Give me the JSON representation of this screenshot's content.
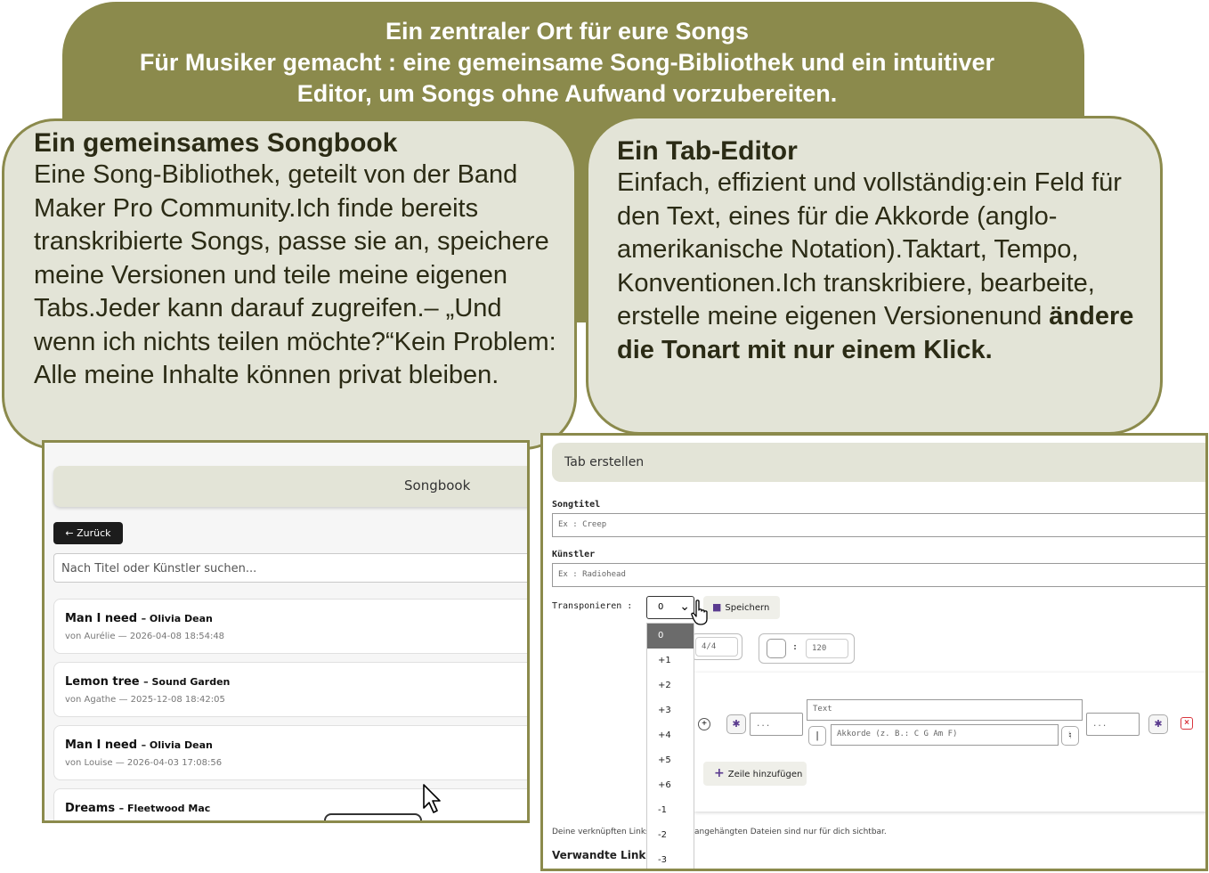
{
  "banner": {
    "line1": "Ein zentraler Ort für eure Songs",
    "line2": "Für Musiker gemacht : eine gemeinsame Song‑Bibliothek und ein intuitiver",
    "line3": "Editor, um Songs ohne Aufwand vorzubereiten."
  },
  "left_card": {
    "title": "Ein gemeinsames Songbook",
    "body": "Eine Song-Bibliothek, geteilt von der Band Maker Pro Community.Ich finde bereits transkribierte Songs, passe sie an, speichere meine Versionen und teile meine eigenen Tabs.Jeder kann darauf zugreifen.– „Und wenn ich nichts teilen möchte?“Kein Problem: Alle meine Inhalte können privat bleiben."
  },
  "right_card": {
    "title": "Ein Tab-Editor",
    "body": "Einfach, effizient und vollständig:ein Feld für den Text, eines für die Akkorde (anglo-amerikanische Notation).Taktart, Tempo, Konventionen.Ich transkribiere, bearbeite, erstelle meine eigenen Versionenund ",
    "body_bold": "ändere die Tonart mit nur einem Klick."
  },
  "songbook": {
    "header": "Songbook",
    "back_label": "← Zurück",
    "search_placeholder": "Nach Titel oder Künstler suchen...",
    "songs": [
      {
        "title": "Man I need",
        "artist": "– Olivia Dean",
        "meta": "von Aurélie — 2026-04-08 18:54:48"
      },
      {
        "title": "Lemon tree",
        "artist": "– Sound Garden",
        "meta": "von Agathe — 2025-12-08 18:42:05"
      },
      {
        "title": "Man I need",
        "artist": "– Olivia Dean",
        "meta": "von Louise — 2026-04-03 17:08:56"
      },
      {
        "title": "Dreams",
        "artist": "– Fleetwood Mac",
        "meta": ""
      }
    ]
  },
  "tab_editor": {
    "header": "Tab erstellen",
    "songtitle_label": "Songtitel",
    "songtitle_placeholder": "Ex : Creep",
    "artist_label": "Künstler",
    "artist_placeholder": "Ex : Radiohead",
    "transpose_label": "Transponieren :",
    "transpose_value": "0",
    "save_label": "Speichern",
    "transpose_options": [
      "0",
      "+1",
      "+2",
      "+3",
      "+4",
      "+5",
      "+6",
      "-1",
      "-2",
      "-3"
    ],
    "time_signature": "4/4",
    "tempo_separator": ":",
    "tempo": "120",
    "text_placeholder": "Text",
    "chords_placeholder": "Akkorde (z. B.: C G Am F)",
    "small_placeholder_1": "...",
    "small_placeholder_2": "...",
    "add_row_label": "Zeile hinzufügen",
    "footnote_left": "Deine verknüpften Links",
    "footnote_right": "angehängten Dateien sind nur für dich sichtbar.",
    "links_title": "Verwandte Links"
  },
  "colors": {
    "olive": "#8b8a4c",
    "card_bg": "#e3e4d7",
    "accent_purple": "#5a3b8f",
    "delete_red": "#d9363e"
  }
}
